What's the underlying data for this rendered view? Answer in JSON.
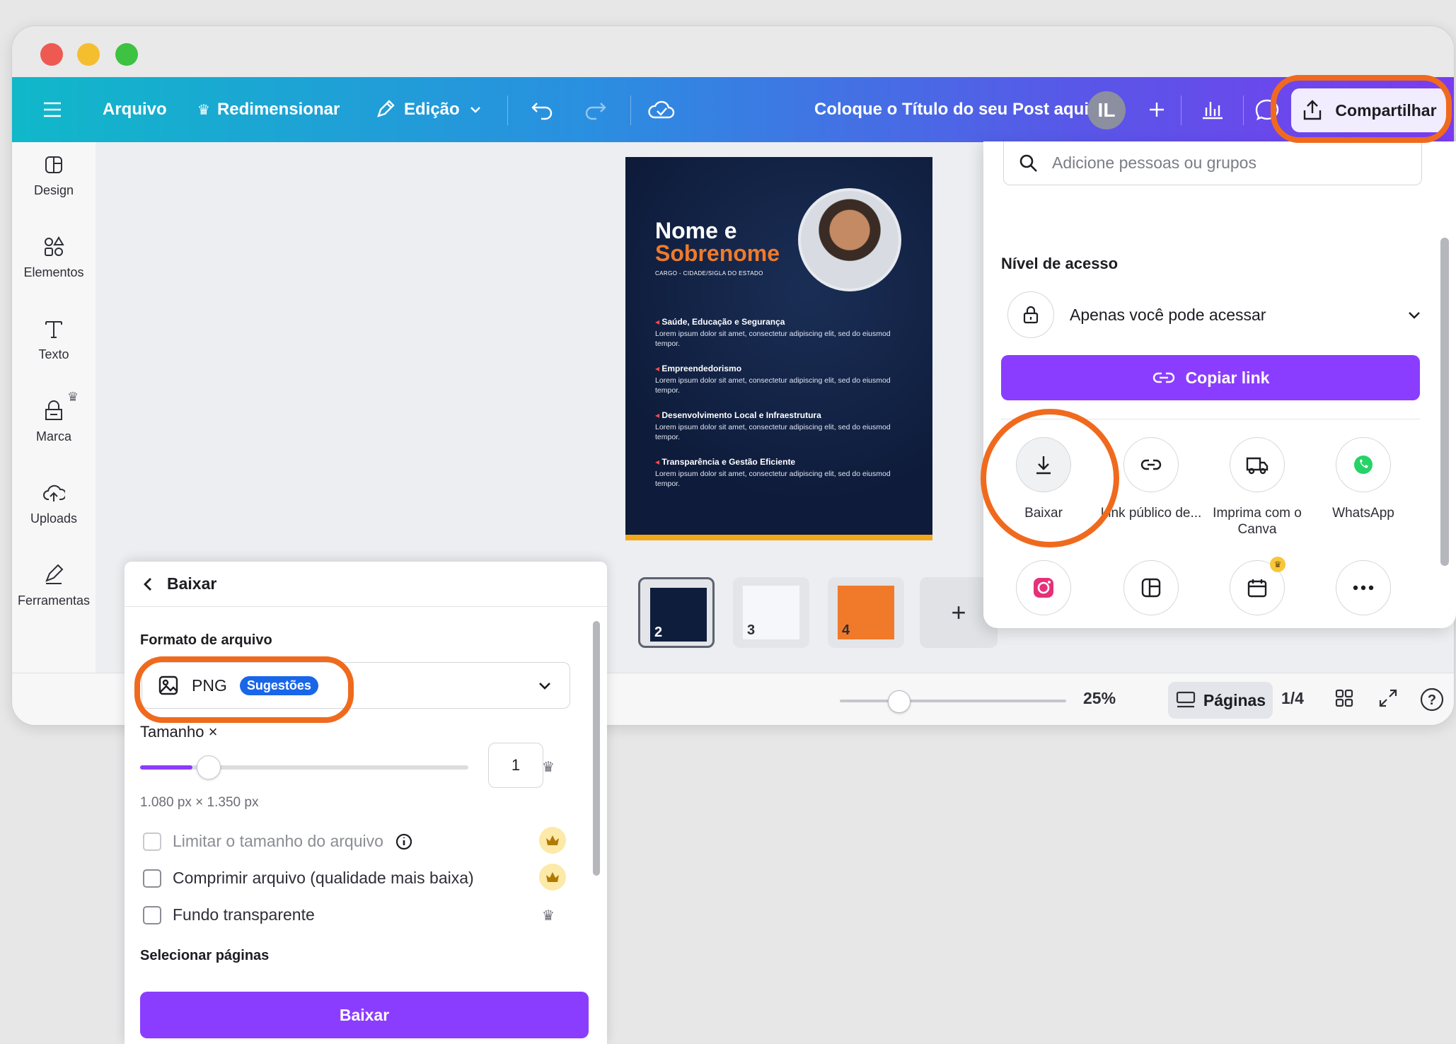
{
  "topbar": {
    "menu_icon": "hamburger-icon",
    "arquivo": "Arquivo",
    "redimensionar": "Redimensionar",
    "edicao": "Edição",
    "title": "Coloque o Título do seu Post aqui",
    "avatar": "IL",
    "share": "Compartilhar"
  },
  "leftnav": [
    {
      "label": "Design",
      "icon": "design-icon"
    },
    {
      "label": "Elementos",
      "icon": "elements-icon"
    },
    {
      "label": "Texto",
      "icon": "text-icon"
    },
    {
      "label": "Marca",
      "icon": "brand-icon"
    },
    {
      "label": "Uploads",
      "icon": "upload-cloud-icon"
    },
    {
      "label": "Ferramentas",
      "icon": "tools-icon"
    }
  ],
  "design": {
    "name_line1": "Nome e",
    "name_line2": "Sobrenome",
    "cargo": "CARGO - CIDADE/SIGLA DO ESTADO",
    "bullets": [
      {
        "title": "Saúde, Educação e Segurança",
        "text": "Lorem ipsum dolor sit amet, consectetur adipiscing elit, sed do eiusmod tempor."
      },
      {
        "title": "Empreendedorismo",
        "text": "Lorem ipsum dolor sit amet, consectetur adipiscing elit, sed do eiusmod tempor."
      },
      {
        "title": "Desenvolvimento Local e Infraestrutura",
        "text": "Lorem ipsum dolor sit amet, consectetur adipiscing elit, sed do eiusmod tempor."
      },
      {
        "title": "Transparência e Gestão Eficiente",
        "text": "Lorem ipsum dolor sit amet, consectetur adipiscing elit, sed do eiusmod tempor."
      }
    ]
  },
  "thumbnails": [
    {
      "page": "2",
      "selected": true
    },
    {
      "page": "3",
      "selected": false
    },
    {
      "page": "4",
      "selected": false
    }
  ],
  "bottombar": {
    "zoom": "25%",
    "pages_label": "Páginas",
    "page_count": "1/4",
    "help": "?"
  },
  "share_panel": {
    "search_placeholder": "Adicione pessoas ou grupos",
    "access_title": "Nível de acesso",
    "access_value": "Apenas você pode acessar",
    "copy_link": "Copiar link",
    "options": [
      {
        "label": "Baixar",
        "icon": "download-icon"
      },
      {
        "label": "Link público de...",
        "icon": "link-icon"
      },
      {
        "label": "Imprima com o Canva",
        "icon": "truck-icon"
      },
      {
        "label": "WhatsApp",
        "icon": "whatsapp-icon"
      }
    ],
    "more_options": [
      {
        "icon": "instagram-icon"
      },
      {
        "icon": "template-icon"
      },
      {
        "icon": "calendar-icon"
      },
      {
        "icon": "more-icon"
      }
    ]
  },
  "download_panel": {
    "title": "Baixar",
    "format_label": "Formato de arquivo",
    "format_value": "PNG",
    "format_badge": "Sugestões",
    "size_label": "Tamanho ×",
    "size_value": "1",
    "size_fraction": 0.16,
    "dimensions": "1.080 px × 1.350 px",
    "limit_size": "Limitar o tamanho do arquivo",
    "compress": "Comprimir arquivo (qualidade mais baixa)",
    "transparent": "Fundo transparente",
    "select_pages": "Selecionar páginas",
    "button": "Baixar"
  },
  "colors": {
    "accent_purple": "#8b3dff",
    "highlight_orange": "#f06a1e",
    "badge_blue": "#1967e8"
  }
}
